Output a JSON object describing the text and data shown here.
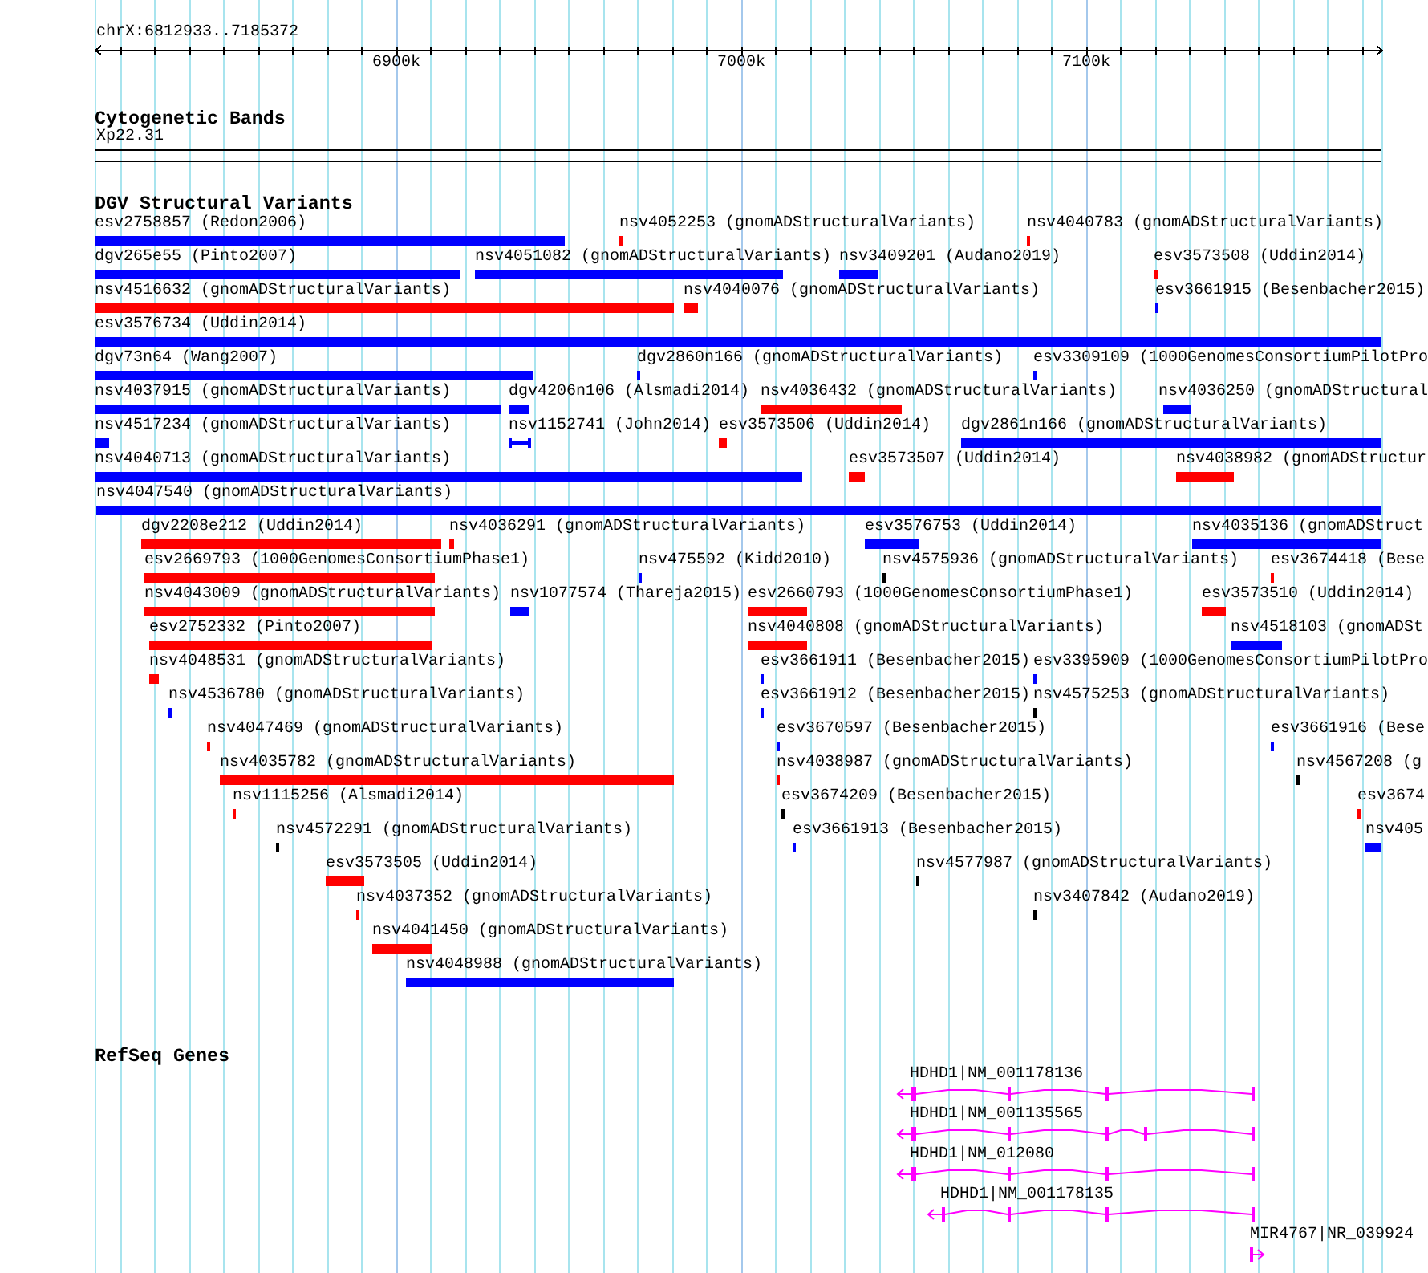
{
  "ruler": {
    "region": "chrX:6812933..7185372",
    "ticks": [
      "6900k",
      "7000k",
      "7100k"
    ]
  },
  "tracks": [
    {
      "kind": "cytoband",
      "title": "Cytogenetic Bands",
      "bands": [
        {
          "name": "Xp22.31"
        }
      ]
    },
    {
      "kind": "variants",
      "title": "DGV Structural Variants",
      "rows": [
        {
          "features": [
            {
              "label": "esv2758857 (Redon2006)",
              "color": "#0000ff",
              "kind": "bar"
            },
            {
              "label": "nsv4052253 (gnomADStructuralVariants)",
              "color": "#ff0000",
              "kind": "bar"
            },
            {
              "label": "nsv4040783 (gnomADStructuralVariants)",
              "color": "#ff0000",
              "kind": "bar"
            }
          ]
        },
        {
          "features": [
            {
              "label": "dgv265e55 (Pinto2007)",
              "color": "#0000ff",
              "kind": "bar"
            },
            {
              "label": "nsv4051082 (gnomADStructuralVariants)",
              "color": "#0000ff",
              "kind": "bar"
            },
            {
              "label": "nsv3409201 (Audano2019)",
              "color": "#0000ff",
              "kind": "bar"
            },
            {
              "label": "esv3573508 (Uddin2014)",
              "color": "#ff0000",
              "kind": "bar"
            }
          ]
        },
        {
          "features": [
            {
              "label": "nsv4516632 (gnomADStructuralVariants)",
              "color": "#ff0000",
              "kind": "bar"
            },
            {
              "label": "nsv4040076 (gnomADStructuralVariants)",
              "color": "#ff0000",
              "kind": "bar"
            },
            {
              "label": "esv3661915 (Besenbacher2015)",
              "color": "#0000ff",
              "kind": "bar"
            }
          ]
        },
        {
          "features": [
            {
              "label": "esv3576734 (Uddin2014)",
              "color": "#0000ff",
              "kind": "bar"
            }
          ]
        },
        {
          "features": [
            {
              "label": "dgv73n64 (Wang2007)",
              "color": "#0000ff",
              "kind": "bar"
            },
            {
              "label": "dgv2860n166 (gnomADStructuralVariants)",
              "color": "#0000ff",
              "kind": "bar"
            },
            {
              "label": "esv3309109 (1000GenomesConsortiumPilotPro",
              "color": "#0000ff",
              "kind": "bar"
            }
          ]
        },
        {
          "features": [
            {
              "label": "nsv4037915 (gnomADStructuralVariants)",
              "color": "#0000ff",
              "kind": "bar"
            },
            {
              "label": "dgv4206n106 (Alsmadi2014)",
              "color": "#0000ff",
              "kind": "bar"
            },
            {
              "label": "nsv4036432 (gnomADStructuralVariants)",
              "color": "#ff0000",
              "kind": "bar"
            },
            {
              "label": "nsv4036250 (gnomADStructural",
              "color": "#0000ff",
              "kind": "bar"
            }
          ]
        },
        {
          "features": [
            {
              "label": "nsv4517234 (gnomADStructuralVariants)",
              "color": "#0000ff",
              "kind": "bar"
            },
            {
              "label": "nsv1152741 (John2014)",
              "color": "#0000ff",
              "kind": "interval"
            },
            {
              "label": "esv3573506 (Uddin2014)",
              "color": "#ff0000",
              "kind": "bar"
            },
            {
              "label": "dgv2861n166 (gnomADStructuralVariants)",
              "color": "#0000ff",
              "kind": "bar"
            }
          ]
        },
        {
          "features": [
            {
              "label": "nsv4040713 (gnomADStructuralVariants)",
              "color": "#0000ff",
              "kind": "bar"
            },
            {
              "label": "esv3573507 (Uddin2014)",
              "color": "#ff0000",
              "kind": "bar"
            },
            {
              "label": "nsv4038982 (gnomADStructur",
              "color": "#ff0000",
              "kind": "bar"
            }
          ]
        },
        {
          "features": [
            {
              "label": "nsv4047540 (gnomADStructuralVariants)",
              "color": "#0000ff",
              "kind": "bar"
            }
          ]
        },
        {
          "features": [
            {
              "label": "dgv2208e212 (Uddin2014)",
              "color": "#ff0000",
              "kind": "bar"
            },
            {
              "label": "nsv4036291 (gnomADStructuralVariants)",
              "color": "#ff0000",
              "kind": "bar"
            },
            {
              "label": "esv3576753 (Uddin2014)",
              "color": "#0000ff",
              "kind": "bar"
            },
            {
              "label": "nsv4035136 (gnomADStruct",
              "color": "#0000ff",
              "kind": "bar"
            }
          ]
        },
        {
          "features": [
            {
              "label": "esv2669793 (1000GenomesConsortiumPhase1)",
              "color": "#ff0000",
              "kind": "bar"
            },
            {
              "label": "nsv475592 (Kidd2010)",
              "color": "#0000ff",
              "kind": "bar"
            },
            {
              "label": "nsv4575936 (gnomADStructuralVariants)",
              "color": "#000000",
              "kind": "bar"
            },
            {
              "label": "esv3674418 (Bese",
              "color": "#ff0000",
              "kind": "bar"
            }
          ]
        },
        {
          "features": [
            {
              "label": "nsv4043009 (gnomADStructuralVariants)",
              "color": "#ff0000",
              "kind": "bar"
            },
            {
              "label": "nsv1077574 (Thareja2015)",
              "color": "#0000ff",
              "kind": "bar"
            },
            {
              "label": "esv2660793 (1000GenomesConsortiumPhase1)",
              "color": "#ff0000",
              "kind": "bar"
            },
            {
              "label": "esv3573510 (Uddin2014)",
              "color": "#ff0000",
              "kind": "bar"
            }
          ]
        },
        {
          "features": [
            {
              "label": "esv2752332 (Pinto2007)",
              "color": "#ff0000",
              "kind": "bar"
            },
            {
              "label": "nsv4040808 (gnomADStructuralVariants)",
              "color": "#ff0000",
              "kind": "bar"
            },
            {
              "label": "nsv4518103 (gnomADSt",
              "color": "#0000ff",
              "kind": "bar"
            }
          ]
        },
        {
          "features": [
            {
              "label": "nsv4048531 (gnomADStructuralVariants)",
              "color": "#ff0000",
              "kind": "bar"
            },
            {
              "label": "esv3661911 (Besenbacher2015)",
              "color": "#0000ff",
              "kind": "bar"
            },
            {
              "label": "esv3395909 (1000GenomesConsortiumPilotPro",
              "color": "#0000ff",
              "kind": "bar"
            }
          ]
        },
        {
          "features": [
            {
              "label": "nsv4536780 (gnomADStructuralVariants)",
              "color": "#0000ff",
              "kind": "bar"
            },
            {
              "label": "esv3661912 (Besenbacher2015)",
              "color": "#0000ff",
              "kind": "bar"
            },
            {
              "label": "nsv4575253 (gnomADStructuralVariants)",
              "color": "#000000",
              "kind": "bar"
            }
          ]
        },
        {
          "features": [
            {
              "label": "nsv4047469 (gnomADStructuralVariants)",
              "color": "#ff0000",
              "kind": "bar"
            },
            {
              "label": "esv3670597 (Besenbacher2015)",
              "color": "#0000ff",
              "kind": "bar"
            },
            {
              "label": "esv3661916 (Bese",
              "color": "#0000ff",
              "kind": "bar"
            }
          ]
        },
        {
          "features": [
            {
              "label": "nsv4035782 (gnomADStructuralVariants)",
              "color": "#ff0000",
              "kind": "bar"
            },
            {
              "label": "nsv4038987 (gnomADStructuralVariants)",
              "color": "#ff0000",
              "kind": "bar"
            },
            {
              "label": "nsv4567208 (g",
              "color": "#000000",
              "kind": "bar"
            }
          ]
        },
        {
          "features": [
            {
              "label": "nsv1115256 (Alsmadi2014)",
              "color": "#ff0000",
              "kind": "bar"
            },
            {
              "label": "esv3674209 (Besenbacher2015)",
              "color": "#000000",
              "kind": "bar"
            },
            {
              "label": "esv3674",
              "color": "#ff0000",
              "kind": "bar"
            }
          ]
        },
        {
          "features": [
            {
              "label": "nsv4572291 (gnomADStructuralVariants)",
              "color": "#000000",
              "kind": "bar"
            },
            {
              "label": "esv3661913 (Besenbacher2015)",
              "color": "#0000ff",
              "kind": "bar"
            },
            {
              "label": "nsv405",
              "color": "#0000ff",
              "kind": "bar"
            }
          ]
        },
        {
          "features": [
            {
              "label": "esv3573505 (Uddin2014)",
              "color": "#ff0000",
              "kind": "bar"
            },
            {
              "label": "nsv4577987 (gnomADStructuralVariants)",
              "color": "#000000",
              "kind": "bar"
            }
          ]
        },
        {
          "features": [
            {
              "label": "nsv4037352 (gnomADStructuralVariants)",
              "color": "#ff0000",
              "kind": "bar"
            },
            {
              "label": "nsv3407842 (Audano2019)",
              "color": "#000000",
              "kind": "bar"
            }
          ]
        },
        {
          "features": [
            {
              "label": "nsv4041450 (gnomADStructuralVariants)",
              "color": "#ff0000",
              "kind": "bar"
            }
          ]
        },
        {
          "features": [
            {
              "label": "nsv4048988 (gnomADStructuralVariants)",
              "color": "#0000ff",
              "kind": "bar"
            }
          ]
        }
      ]
    },
    {
      "kind": "genes",
      "title": "RefSeq Genes",
      "genes": [
        {
          "label": "HDHD1|NM_001178136",
          "reverse": true
        },
        {
          "label": "HDHD1|NM_001135565",
          "reverse": true
        },
        {
          "label": "HDHD1|NM_012080",
          "reverse": true
        },
        {
          "label": "HDHD1|NM_001178135",
          "reverse": true
        },
        {
          "label": "MIR4767|NR_039924",
          "reverse": false
        }
      ]
    }
  ]
}
